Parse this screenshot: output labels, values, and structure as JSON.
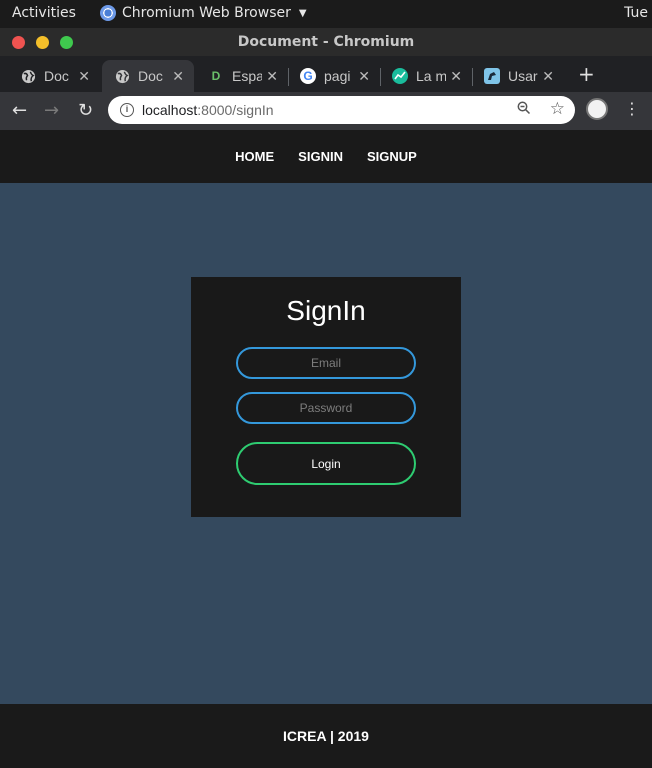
{
  "os_bar": {
    "activities": "Activities",
    "app_name": "Chromium Web Browser",
    "clock": "Tue"
  },
  "window": {
    "title": "Document - Chromium"
  },
  "tabs": [
    {
      "title": "Doc",
      "favicon": "globe-icon",
      "active": false
    },
    {
      "title": "Doc",
      "favicon": "globe-icon",
      "active": true
    },
    {
      "title": "Espa",
      "favicon": "D",
      "active": false
    },
    {
      "title": "pagi",
      "favicon": "G",
      "active": false
    },
    {
      "title": "La m",
      "favicon": "chart-icon",
      "active": false
    },
    {
      "title": "Usar",
      "favicon": "bird-icon",
      "active": false
    }
  ],
  "address": {
    "host": "localhost",
    "path": ":8000/signIn"
  },
  "nav": {
    "home": "HOME",
    "signin": "SIGNIN",
    "signup": "SIGNUP"
  },
  "login": {
    "title": "SignIn",
    "email_placeholder": "Email",
    "password_placeholder": "Password",
    "button": "Login"
  },
  "footer": {
    "text": "ICREA | 2019"
  },
  "colors": {
    "page_bg": "#34495e",
    "panel_bg": "#191919",
    "input_border": "#3498db",
    "button_border": "#2ecc71"
  }
}
